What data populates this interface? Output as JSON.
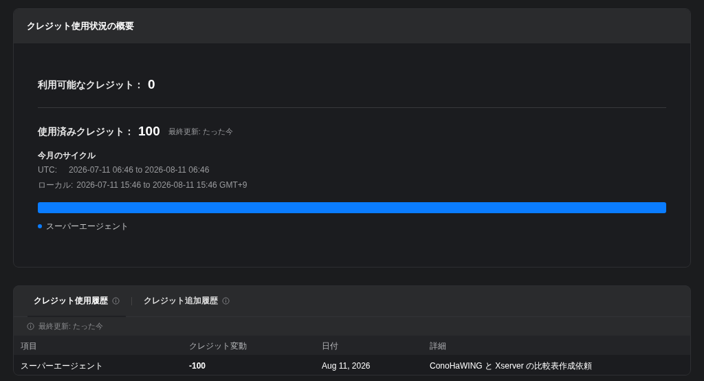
{
  "summary": {
    "title": "クレジット使用状況の概要",
    "available": {
      "label": "利用可能なクレジット：",
      "value": "0"
    },
    "used": {
      "label": "使用済みクレジット：",
      "value": "100",
      "updated": "最終更新: たった今"
    },
    "cycle": {
      "title": "今月のサイクル",
      "utc_label": "UTC:",
      "utc_range": "2026-07-11 06:46 to 2026-08-11 06:46",
      "local_label": "ローカル:",
      "local_range": "2026-07-11 15:46 to 2026-08-11 15:46 GMT+9"
    },
    "usage_bar": [
      {
        "label": "スーパーエージェント",
        "level": 1,
        "color": "#0a7cff"
      }
    ]
  },
  "history": {
    "tabs": [
      {
        "label": "クレジット使用履歴",
        "selected": true
      },
      {
        "label": "クレジット追加履歴",
        "selected": false
      }
    ],
    "updated": "最終更新: たった今",
    "table": {
      "columns": [
        "項目",
        "クレジット変動",
        "日付",
        "詳細"
      ],
      "rows": [
        [
          "スーパーエージェント",
          "-100",
          "Aug 11, 2026",
          "ConoHaWING と Xserver の比較表作成依頼"
        ]
      ]
    }
  }
}
